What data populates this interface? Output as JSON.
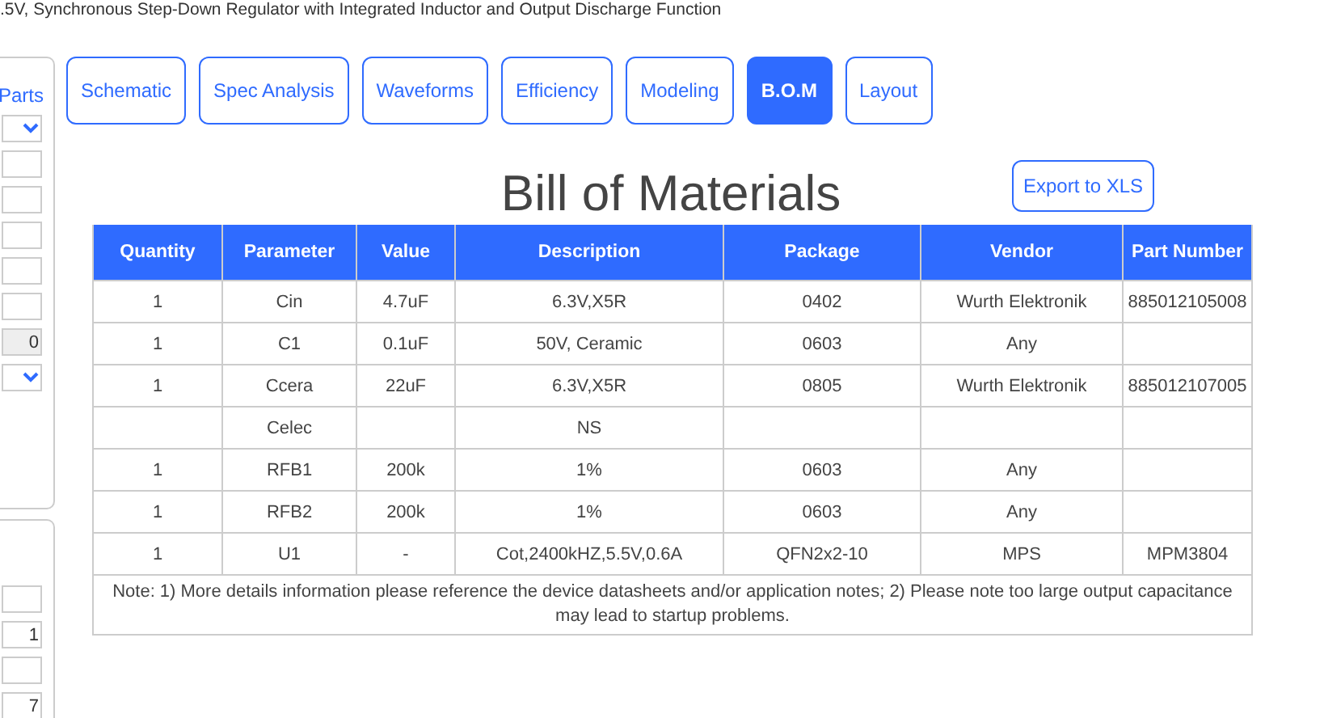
{
  "page_title": ".5V, Synchronous Step-Down Regulator with Integrated Inductor and Output Discharge Function",
  "sidebar": {
    "link": "Parts",
    "fields": [
      {
        "kind": "select",
        "disabled": false
      },
      {
        "kind": "input",
        "disabled": false
      },
      {
        "kind": "input",
        "disabled": false
      },
      {
        "kind": "input",
        "disabled": false
      },
      {
        "kind": "input",
        "disabled": false
      },
      {
        "kind": "input",
        "disabled": false
      },
      {
        "kind": "input",
        "value": "0",
        "disabled": true
      },
      {
        "kind": "select",
        "disabled": false
      }
    ],
    "fields_2": [
      {
        "kind": "input",
        "disabled": false
      },
      {
        "kind": "input",
        "value": "1",
        "disabled": false
      },
      {
        "kind": "input",
        "disabled": false
      },
      {
        "kind": "input",
        "value": "7",
        "disabled": false
      }
    ]
  },
  "tabs": [
    {
      "label": "Schematic",
      "selected": false
    },
    {
      "label": "Spec Analysis",
      "selected": false
    },
    {
      "label": "Waveforms",
      "selected": false
    },
    {
      "label": "Efficiency",
      "selected": false
    },
    {
      "label": "Modeling",
      "selected": false
    },
    {
      "label": "B.O.M",
      "selected": true
    },
    {
      "label": "Layout",
      "selected": false
    }
  ],
  "title": "Bill of Materials",
  "export_button": "Export to XLS",
  "table": {
    "columns": [
      "Quantity",
      "Parameter",
      "Value",
      "Description",
      "Package",
      "Vendor",
      "Part Number"
    ],
    "rows": [
      [
        "1",
        "Cin",
        "4.7uF",
        "6.3V,X5R",
        "0402",
        "Wurth Elektronik",
        "885012105008"
      ],
      [
        "1",
        "C1",
        "0.1uF",
        "50V, Ceramic",
        "0603",
        "Any",
        null
      ],
      [
        "1",
        "Ccera",
        "22uF",
        "6.3V,X5R",
        "0805",
        "Wurth Elektronik",
        "885012107005"
      ],
      [
        null,
        "Celec",
        null,
        "NS",
        null,
        null,
        null
      ],
      [
        "1",
        "RFB1",
        "200k",
        "1%",
        "0603",
        "Any",
        null
      ],
      [
        "1",
        "RFB2",
        "200k",
        "1%",
        "0603",
        "Any",
        null
      ],
      [
        "1",
        "U1",
        "-",
        "Cot,2400kHZ,5.5V,0.6A",
        "QFN2x2-10",
        "MPS",
        "MPM3804"
      ]
    ],
    "note": "Note: 1) More details information please reference the device datasheets and/or application notes; 2) Please note too large output capacitance may lead to startup problems."
  }
}
